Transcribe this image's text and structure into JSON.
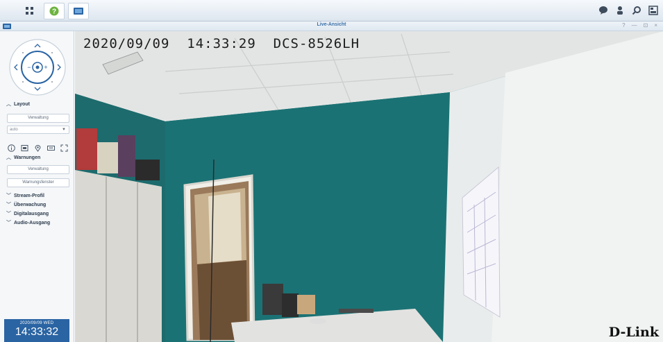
{
  "taskbar": {
    "left_apps": [
      "main-menu",
      "help-app",
      "surveillance-app"
    ],
    "right_icons": [
      "chat-icon",
      "user-icon",
      "search-icon",
      "widgets-icon"
    ]
  },
  "window": {
    "title": "Live-Ansicht",
    "controls": [
      "?",
      "—",
      "⊡",
      "×"
    ]
  },
  "sidebar": {
    "layout": {
      "heading": "Layout",
      "manage_label": "Verwaltung",
      "select_value": "auto"
    },
    "warnings": {
      "heading": "Warnungen",
      "manage_label": "Verwaltung",
      "window_label": "Warnungsfenster"
    },
    "collapsed_sections": [
      "Stream-Profil",
      "Überwachung",
      "Digitalausgang",
      "Audio-Ausgang"
    ],
    "clock": {
      "date": "2020/09/09 WED",
      "time": "14:33:32"
    }
  },
  "camera": {
    "overlay": "2020/09/09  14:33:29  DCS-8526LH",
    "brand": "D-Link"
  },
  "colors": {
    "accent": "#2a64a3",
    "wall": "#1b6e71",
    "ceiling": "#e4e6e5"
  }
}
